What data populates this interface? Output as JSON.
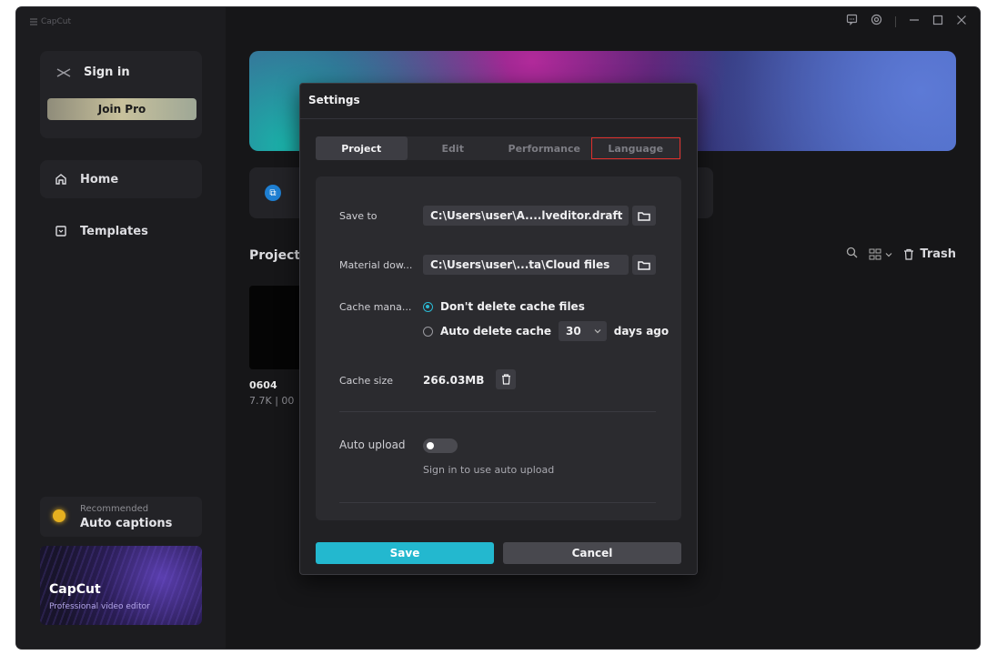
{
  "app": {
    "logo_text": "CapCut"
  },
  "sidebar": {
    "sign_in": "Sign in",
    "join_pro": "Join Pro",
    "nav": [
      {
        "label": "Home",
        "icon": "home-icon"
      },
      {
        "label": "Templates",
        "icon": "templates-icon"
      }
    ],
    "recommended_label": "Recommended",
    "recommended_title": "Auto captions",
    "promo_title": "CapCut",
    "promo_subtitle": "Professional video editor"
  },
  "main": {
    "projects_title": "Projects",
    "project": {
      "name": "0604",
      "meta": "7.7K | 00"
    },
    "trash_label": "Trash"
  },
  "settings": {
    "title": "Settings",
    "tabs": [
      {
        "label": "Project",
        "active": true
      },
      {
        "label": "Edit",
        "active": false
      },
      {
        "label": "Performance",
        "active": false
      },
      {
        "label": "Language",
        "active": false,
        "highlighted": true
      }
    ],
    "save_to_label": "Save to",
    "save_to_path": "C:\\Users\\user\\A....lveditor.draft",
    "material_label": "Material dow...",
    "material_path": "C:\\Users\\user\\...ta\\Cloud files",
    "cache_label": "Cache mana...",
    "cache_option_1": "Don't delete cache files",
    "cache_option_2": "Auto delete cache",
    "cache_days_value": "30",
    "cache_days_suffix": "days ago",
    "cache_size_label": "Cache size",
    "cache_size_value": "266.03MB",
    "auto_upload_label": "Auto upload",
    "auto_upload_hint": "Sign in to use auto upload",
    "save_button": "Save",
    "cancel_button": "Cancel"
  },
  "colors": {
    "accent": "#23b8cf",
    "highlight_box": "#e0302c",
    "background": "#18181a"
  }
}
